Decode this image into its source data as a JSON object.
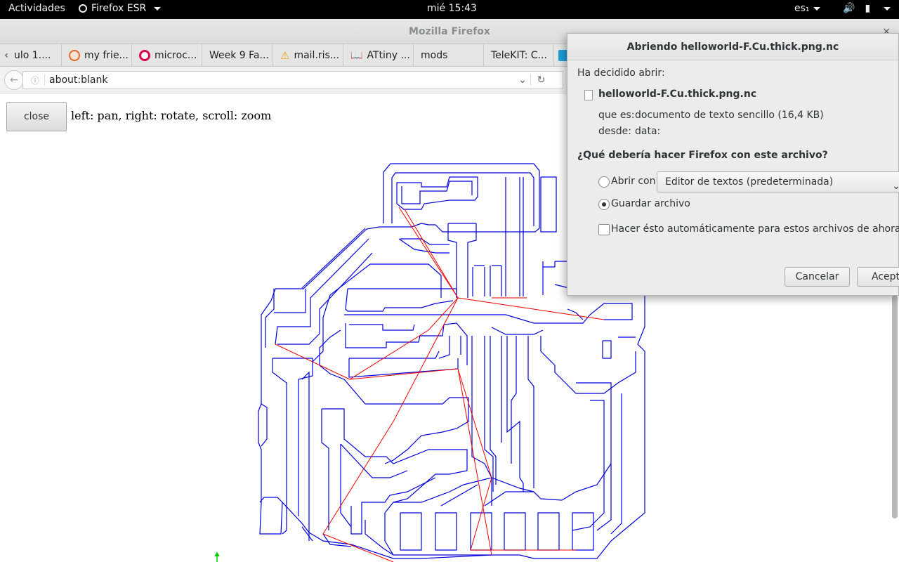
{
  "topbar": {
    "activities": "Actividades",
    "app_menu": "Firefox ESR",
    "clock": "mié 15:43",
    "language": "es₁",
    "icons": [
      "volume-icon",
      "battery-icon",
      "system-menu-caret-icon"
    ]
  },
  "window": {
    "title": "Mozilla Firefox",
    "close": "×"
  },
  "tabs": [
    {
      "label": "ulo 1....",
      "icon": "none"
    },
    {
      "label": "my frie...",
      "icon": "avatar-icon",
      "color": "#e0692a"
    },
    {
      "label": "microc...",
      "icon": "debian-icon",
      "color": "#d70751"
    },
    {
      "label": "Week 9 Fa...",
      "icon": "none"
    },
    {
      "label": "mail.ris...",
      "icon": "warning-icon",
      "color": "#f0a30a"
    },
    {
      "label": "ATtiny ...",
      "icon": "book-icon",
      "color": "#333333"
    },
    {
      "label": "mods",
      "icon": "none"
    },
    {
      "label": "TeleKIT: C...",
      "icon": "none"
    }
  ],
  "navbar": {
    "url": "about:blank"
  },
  "page": {
    "close_button": "close",
    "hint": "left: pan, right: rotate, scroll: zoom",
    "trace_color": "#0000dd",
    "rapid_color": "#ee0000",
    "origin_color": "#00cc00"
  },
  "dialog": {
    "title": "Abriendo helloworld-F.Cu.thick.png.nc",
    "intro": "Ha decidido abrir:",
    "filename": "helloworld-F.Cu.thick.png.nc",
    "type_label": "que es:",
    "type_value": "documento de texto sencillo (16,4 KB)",
    "from_label": "desde:",
    "from_value": "data:",
    "question": "¿Qué debería hacer Firefox con este archivo?",
    "open_with_label": "Abrir con",
    "open_with_selected": false,
    "editor_value": "Editor de textos (predeterminada)",
    "save_label": "Guardar archivo",
    "save_selected": true,
    "auto_label": "Hacer ésto automáticamente para estos archivos de ahora en más.",
    "auto_checked": false,
    "cancel": "Cancelar",
    "accept": "Aceptar"
  }
}
